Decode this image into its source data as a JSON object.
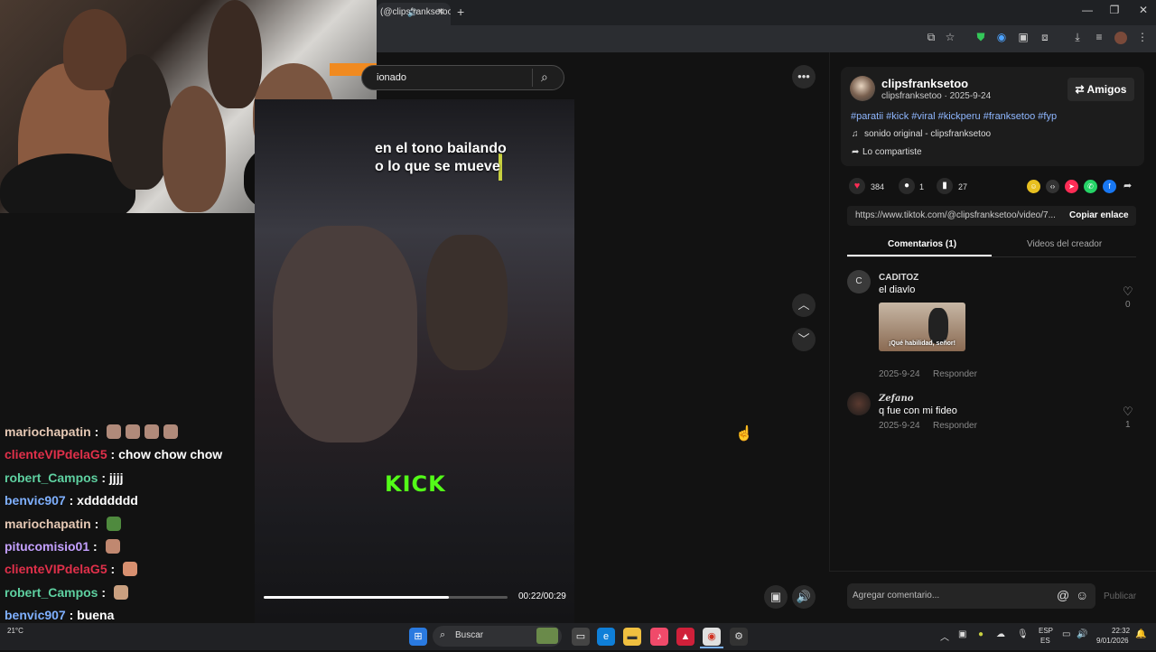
{
  "browser": {
    "tab_title": "(@clipsfranksetoo",
    "tab_close": "✕",
    "new_tab": "+",
    "window_minimize": "—",
    "window_restore": "❐",
    "window_close": "✕"
  },
  "search": {
    "value": "ionado"
  },
  "video": {
    "caption_line1": "en el tono bailando",
    "caption_line2": "o lo que se mueve",
    "watermark": "KICK",
    "time": "00:22/00:29",
    "progress": 0.76
  },
  "chat": {
    "messages": [
      {
        "user": "mariochapatin",
        "color": "#e6c9b5",
        "text": "",
        "emotes": [
          "#b08a7a",
          "#b08a7a",
          "#b08a7a",
          "#b08a7a"
        ]
      },
      {
        "user": "clienteVIPdelaG5",
        "color": "#e0304a",
        "text": "chow chow chow",
        "emotes": []
      },
      {
        "user": "robert_Campos",
        "color": "#5ed0a0",
        "text": "jjjj",
        "emotes": []
      },
      {
        "user": "benvic907",
        "color": "#7fb0ff",
        "text": "xddddddd",
        "emotes": []
      },
      {
        "user": "mariochapatin",
        "color": "#e6c9b5",
        "text": "",
        "emotes": [
          "#4f8a3e"
        ]
      },
      {
        "user": "pitucomisio01",
        "color": "#c4a0ff",
        "text": "",
        "emotes": [
          "#c08870"
        ]
      },
      {
        "user": "clienteVIPdelaG5",
        "color": "#e0304a",
        "text": "",
        "emotes": [
          "#d89070"
        ]
      },
      {
        "user": "robert_Campos",
        "color": "#5ed0a0",
        "text": "",
        "emotes": [
          "#caa080"
        ]
      },
      {
        "user": "benvic907",
        "color": "#7fb0ff",
        "text": "buena",
        "emotes": []
      },
      {
        "user": "mariochapatin",
        "color": "#e6c9b5",
        "text": "",
        "emotes": [
          "#e8d840"
        ]
      }
    ]
  },
  "panel": {
    "author": "clipsfranksetoo",
    "author_meta": "clipsfranksetoo · 2025-9-24",
    "friends_label": "Amigos",
    "hashtags": "#paratii #kick #viral #kickperu #franksetoo #fyp",
    "sound": "sonido original - clipsfranksetoo",
    "shared": "Lo compartiste",
    "likes": "384",
    "comments_count": "1",
    "saves": "27",
    "link": "https://www.tiktok.com/@clipsfranksetoo/video/7...",
    "copy_link": "Copiar enlace",
    "tab_comments": "Comentarios (1)",
    "tab_videos": "Videos del creador",
    "comments": [
      {
        "initial": "C",
        "name": "CADITOZ",
        "text": "el diavlo",
        "date": "2025-9-24",
        "reply": "Responder",
        "likes": "0",
        "gif_caption": "¡Qué habilidad, señor!"
      },
      {
        "initial": "",
        "name": "Zefano",
        "text": "q fue con mi fideo",
        "date": "2025-9-24",
        "reply": "Responder",
        "likes": "1"
      }
    ],
    "add_comment_placeholder": "Agregar comentario...",
    "publish": "Publicar"
  },
  "taskbar": {
    "weather": "21°C",
    "search_label": "Buscar",
    "lang_top": "ESP",
    "lang_bottom": "ES",
    "time": "22:32",
    "date": "9/01/2026"
  },
  "colors": {
    "kick_green": "#53fc18",
    "hashtag_blue": "#8fb7ff",
    "like_red": "#fe2c55"
  }
}
